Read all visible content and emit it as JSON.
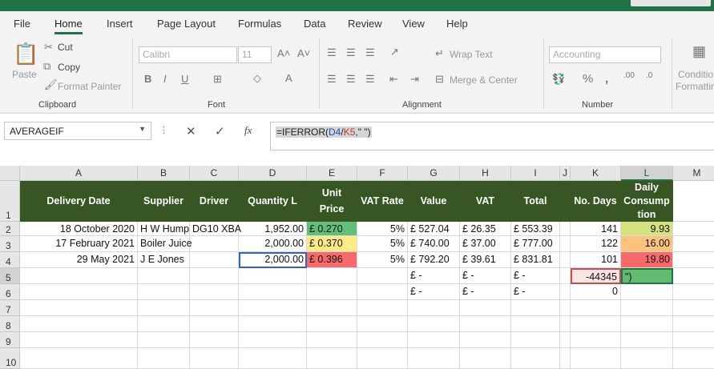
{
  "tabs": [
    "File",
    "Home",
    "Insert",
    "Page Layout",
    "Formulas",
    "Data",
    "Review",
    "View",
    "Help"
  ],
  "ribbon": {
    "clipboard": {
      "paste": "Paste",
      "cut": "Cut",
      "copy": "Copy",
      "format_painter": "Format Painter",
      "label": "Clipboard"
    },
    "font": {
      "name": "Calibri",
      "size": "11",
      "label": "Font"
    },
    "alignment": {
      "wrap": "Wrap Text",
      "merge": "Merge & Center",
      "label": "Alignment"
    },
    "number": {
      "format": "Accounting",
      "label": "Number"
    },
    "styles": {
      "conditional": "Conditio",
      "formatting": "Formattin"
    }
  },
  "name_box": "AVERAGEIF",
  "formula": {
    "prefix": "=IFERROR(",
    "ref1": "D4",
    "slash": "/",
    "ref2": "K5",
    "suffix": ",\" \")"
  },
  "columns": [
    "A",
    "B",
    "C",
    "D",
    "E",
    "F",
    "G",
    "H",
    "I",
    "J",
    "K",
    "L",
    "M"
  ],
  "rows": [
    "1",
    "2",
    "3",
    "4",
    "5",
    "6",
    "7",
    "8",
    "9",
    "10"
  ],
  "headers": {
    "A": "Delivery Date",
    "B": "Supplier",
    "C": "Driver",
    "D": "Quantity L",
    "E1": "Unit",
    "E2": "Price",
    "F": "VAT Rate",
    "G": "Value",
    "H": "VAT",
    "I": "Total",
    "K": "No. Days",
    "L1": "Daily",
    "L2": "Consump",
    "L3": "tion"
  },
  "data": [
    {
      "A": "18 October 2020",
      "B": "H W Hump",
      "C": "DG10 XBA",
      "D": "1,952.00",
      "E": "£  0.270",
      "F": "5%",
      "G": "£ 527.04",
      "H": "£  26.35",
      "I": "£ 553.39",
      "K": "141",
      "L": "9.93"
    },
    {
      "A": "17 February 2021",
      "B": "Boiler Juice",
      "C": "",
      "D": "2,000.00",
      "E": "£  0.370",
      "F": "5%",
      "G": "£ 740.00",
      "H": "£  37.00",
      "I": "£ 777.00",
      "K": "122",
      "L": "16.00"
    },
    {
      "A": "29 May 2021",
      "B": "J E Jones",
      "C": "",
      "D": "2,000.00",
      "E": "£  0.396",
      "F": "5%",
      "G": "£ 792.20",
      "H": "£  39.61",
      "I": "£ 831.81",
      "K": "101",
      "L": "19.80"
    }
  ],
  "row5": {
    "G": "£     -",
    "H": "£     -",
    "I": "£     -",
    "K": "-44345",
    "L": "\")"
  },
  "row6": {
    "G": "£     -",
    "H": "£     -",
    "I": "£     -",
    "K": "0"
  },
  "colors": {
    "accent": "#217346",
    "header_green": "#375623",
    "e2": "#63be7b",
    "e3": "#ffeb84",
    "e4": "#f8696b",
    "l2": "#d3e27d",
    "l3": "#fdc37c",
    "l4": "#f8696b"
  }
}
